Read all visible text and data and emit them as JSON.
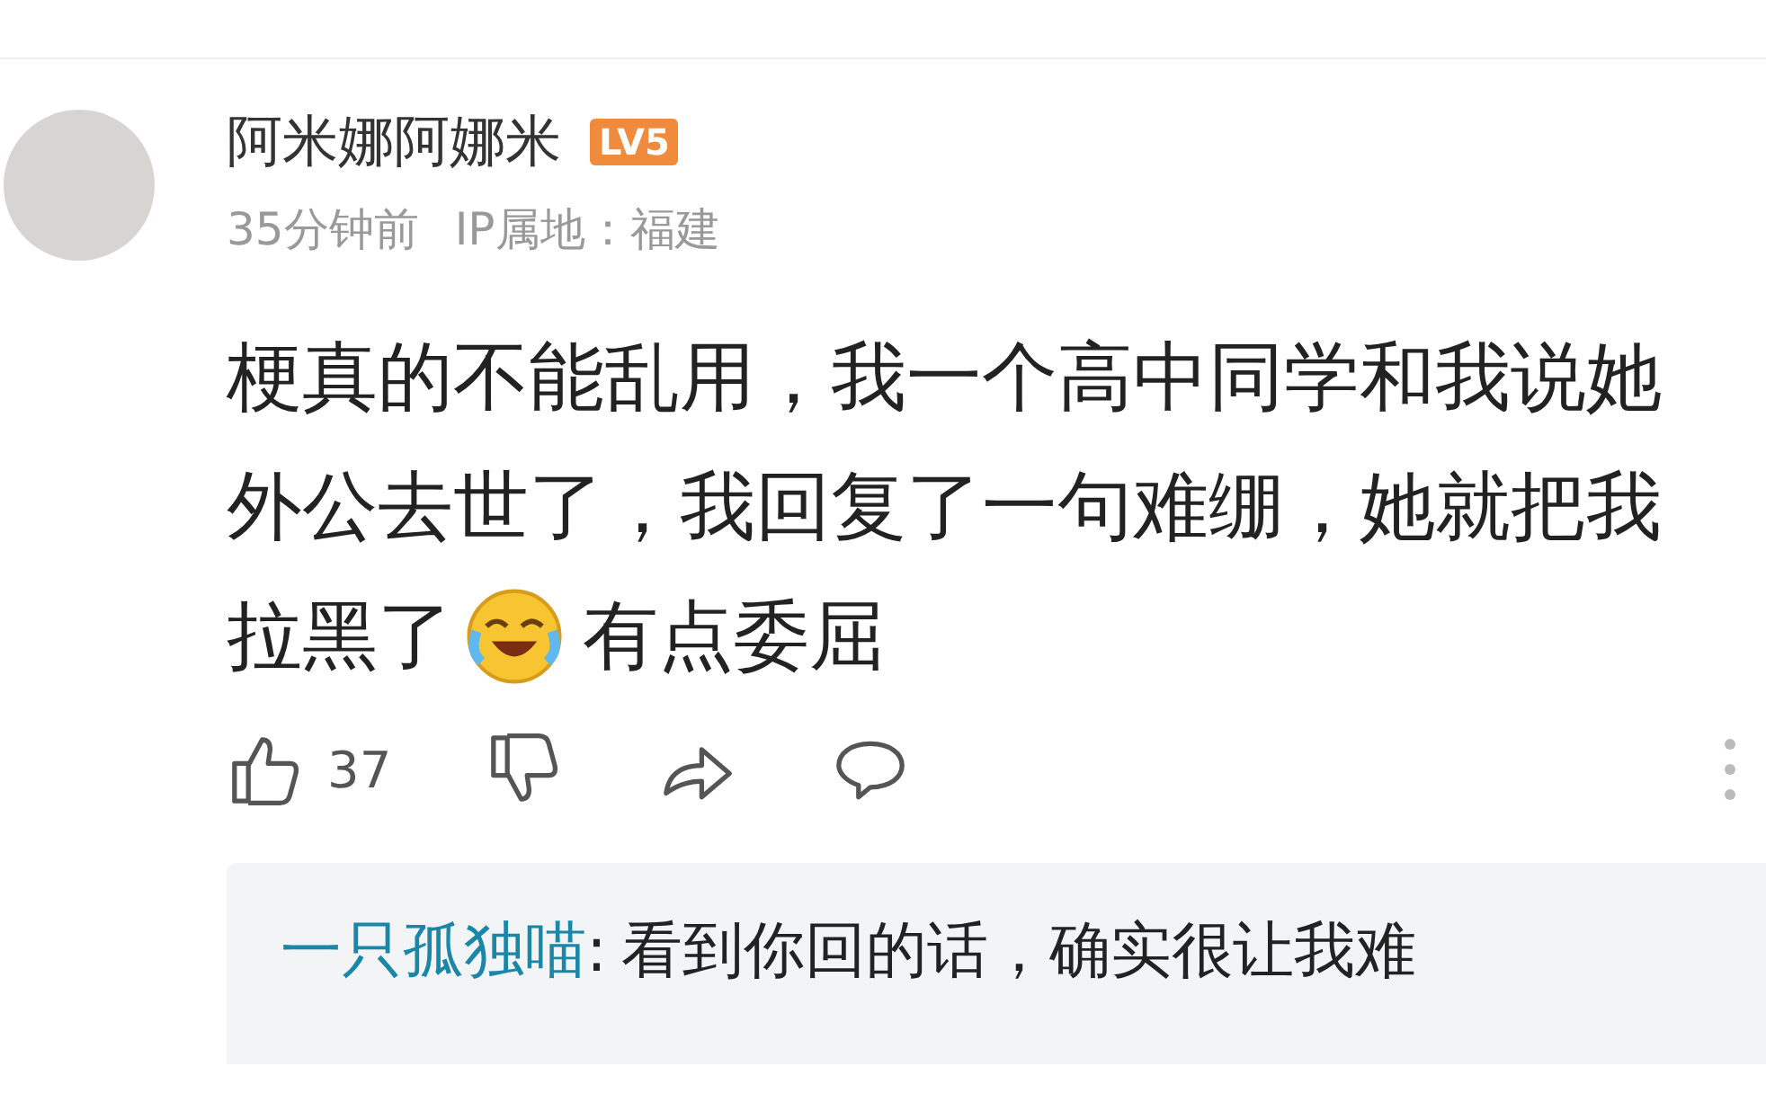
{
  "comment": {
    "username": "阿米娜阿娜米",
    "level_badge": "LV5",
    "time": "35分钟前",
    "ip_location": "IP属地：福建",
    "body_lines": [
      "梗真的不能乱用，我一个高中同学和我说她",
      "外公去世了，我回复了一句难绷，她就把我"
    ],
    "body_before_emoji": "拉黑了",
    "body_after_emoji": "有点委屈",
    "like_count": "37"
  },
  "reply_preview": {
    "username": "一只孤独喵",
    "separator": ":",
    "text": "看到你回的话，确实很让我难"
  }
}
